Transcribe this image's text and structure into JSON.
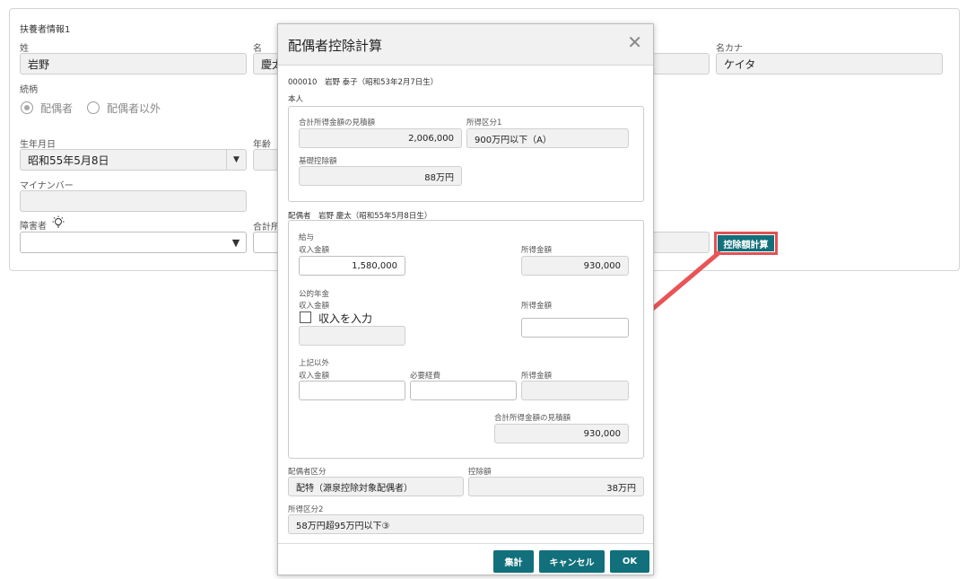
{
  "form": {
    "section_title": "扶養者情報1",
    "last_name_label": "姓",
    "last_name_value": "岩野",
    "first_name_label": "名",
    "first_name_value": "慶太",
    "first_kana_label": "名カナ",
    "first_kana_value": "ケイタ",
    "relation_label": "続柄",
    "relation_options": [
      "配偶者",
      "配偶者以外"
    ],
    "birthdate_label": "生年月日",
    "birthdate_value": "昭和55年5月8日",
    "age_label": "年齢",
    "mynumber_label": "マイナンバー",
    "disability_label": "障害者",
    "total_label": "合計所",
    "calc_button": "控除額計算"
  },
  "dialog": {
    "title": "配偶者控除計算",
    "employee_line": "000010　岩野 泰子（昭和53年2月7日生）",
    "self_section": "本人",
    "self_income_estimate_label": "合計所得金額の見積額",
    "self_income_estimate_value": "2,006,000",
    "self_income_class_label": "所得区分1",
    "self_income_class_value": "900万円以下（A）",
    "basic_deduction_label": "基礎控除額",
    "basic_deduction_value": "88万円",
    "spouse_line": "配偶者　岩野 慶太（昭和55年5月8日生）",
    "salary_label": "給与",
    "salary_income_label": "収入金額",
    "salary_income_value": "1,580,000",
    "salary_earned_label": "所得金額",
    "salary_earned_value": "930,000",
    "pension_label": "公的年金",
    "pension_income_label": "収入金額",
    "pension_checkbox_label": "収入を入力",
    "pension_earned_label": "所得金額",
    "other_label": "上記以外",
    "other_income_label": "収入金額",
    "other_expense_label": "必要経費",
    "other_earned_label": "所得金額",
    "spouse_estimate_label": "合計所得金額の見積額",
    "spouse_estimate_value": "930,000",
    "spouse_class_label": "配偶者区分",
    "spouse_class_value": "配特（源泉控除対象配偶者）",
    "deduction_label": "控除額",
    "deduction_value": "38万円",
    "income_class2_label": "所得区分2",
    "income_class2_value": "58万円超95万円以下③",
    "btn_total": "集計",
    "btn_cancel": "キャンセル",
    "btn_ok": "OK"
  },
  "colors": {
    "accent": "#11707b",
    "highlight": "#e05255"
  }
}
